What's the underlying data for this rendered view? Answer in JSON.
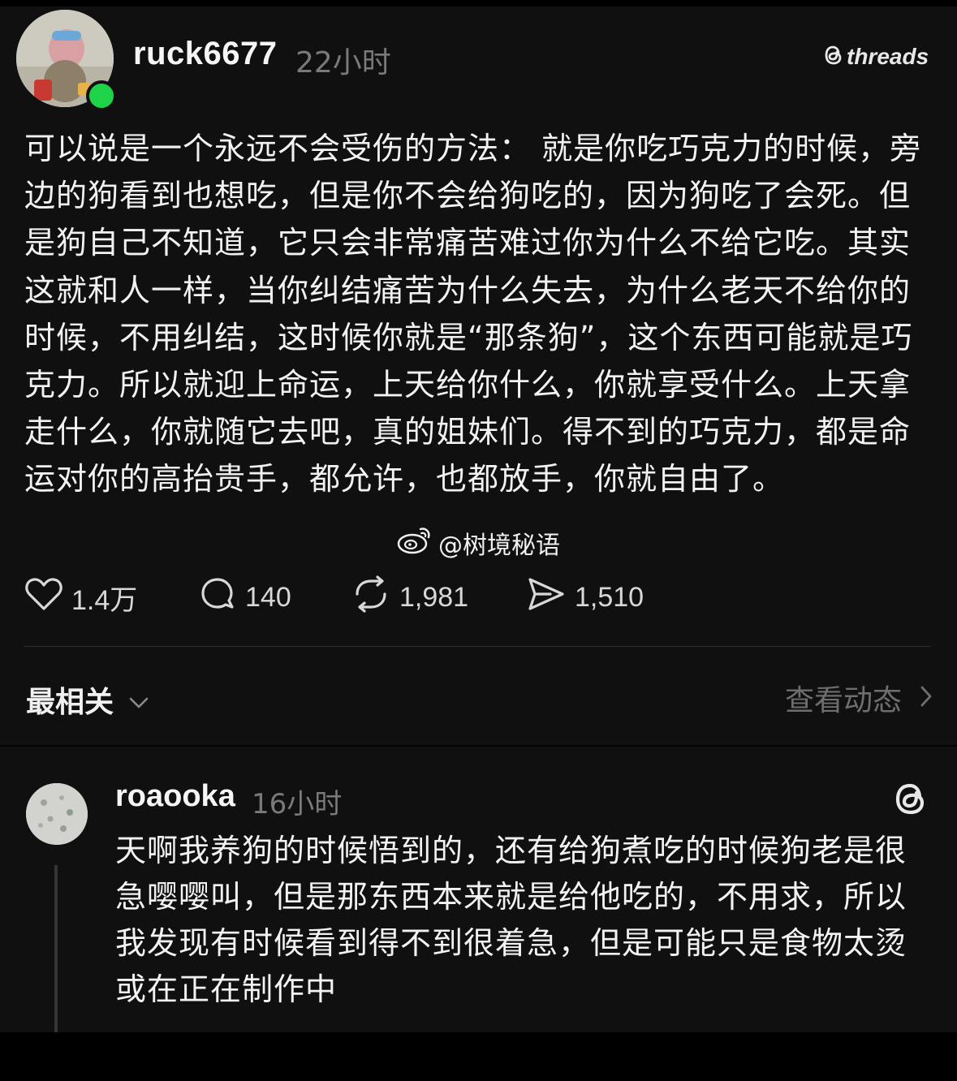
{
  "post": {
    "author": "ruck6677",
    "time": "22小时",
    "brand": "threads",
    "body": "可以说是一个永远不会受伤的方法： 就是你吃巧克力的时候，旁边的狗看到也想吃，但是你不会给狗吃的，因为狗吃了会死。但是狗自己不知道，它只会非常痛苦难过你为什么不给它吃。其实这就和人一样，当你纠结痛苦为什么失去，为什么老天不给你的时候，不用纠结，这时候你就是“那条狗”，这个东西可能就是巧克力。所以就迎上命运，上天给你什么，你就享受什么。上天拿走什么，你就随它去吧，真的姐妹们。得不到的巧克力，都是命运对你的高抬贵手，都允许，也都放手，你就自由了。",
    "watermark": "@树境秘语",
    "stats": {
      "likes": "1.4万",
      "comments": "140",
      "reposts": "1,981",
      "shares": "1,510"
    }
  },
  "sort": {
    "label": "最相关",
    "activity_label": "查看动态"
  },
  "reply": {
    "author": "roaooka",
    "time": "16小时",
    "body": "天啊我养狗的时候悟到的，还有给狗煮吃的时候狗老是很急嘤嘤叫，但是那东西本来就是给他吃的，不用求，所以我发现有时候看到得不到很着急，但是可能只是食物太烫或在正在制作中"
  },
  "colors": {
    "background": "#101010",
    "online": "#1fd348",
    "muted": "#7a7a7a"
  },
  "icons": [
    "heart-icon",
    "comment-icon",
    "repost-icon",
    "share-icon",
    "chevron-down-icon",
    "chevron-right-icon",
    "threads-logo-icon",
    "weibo-icon"
  ]
}
